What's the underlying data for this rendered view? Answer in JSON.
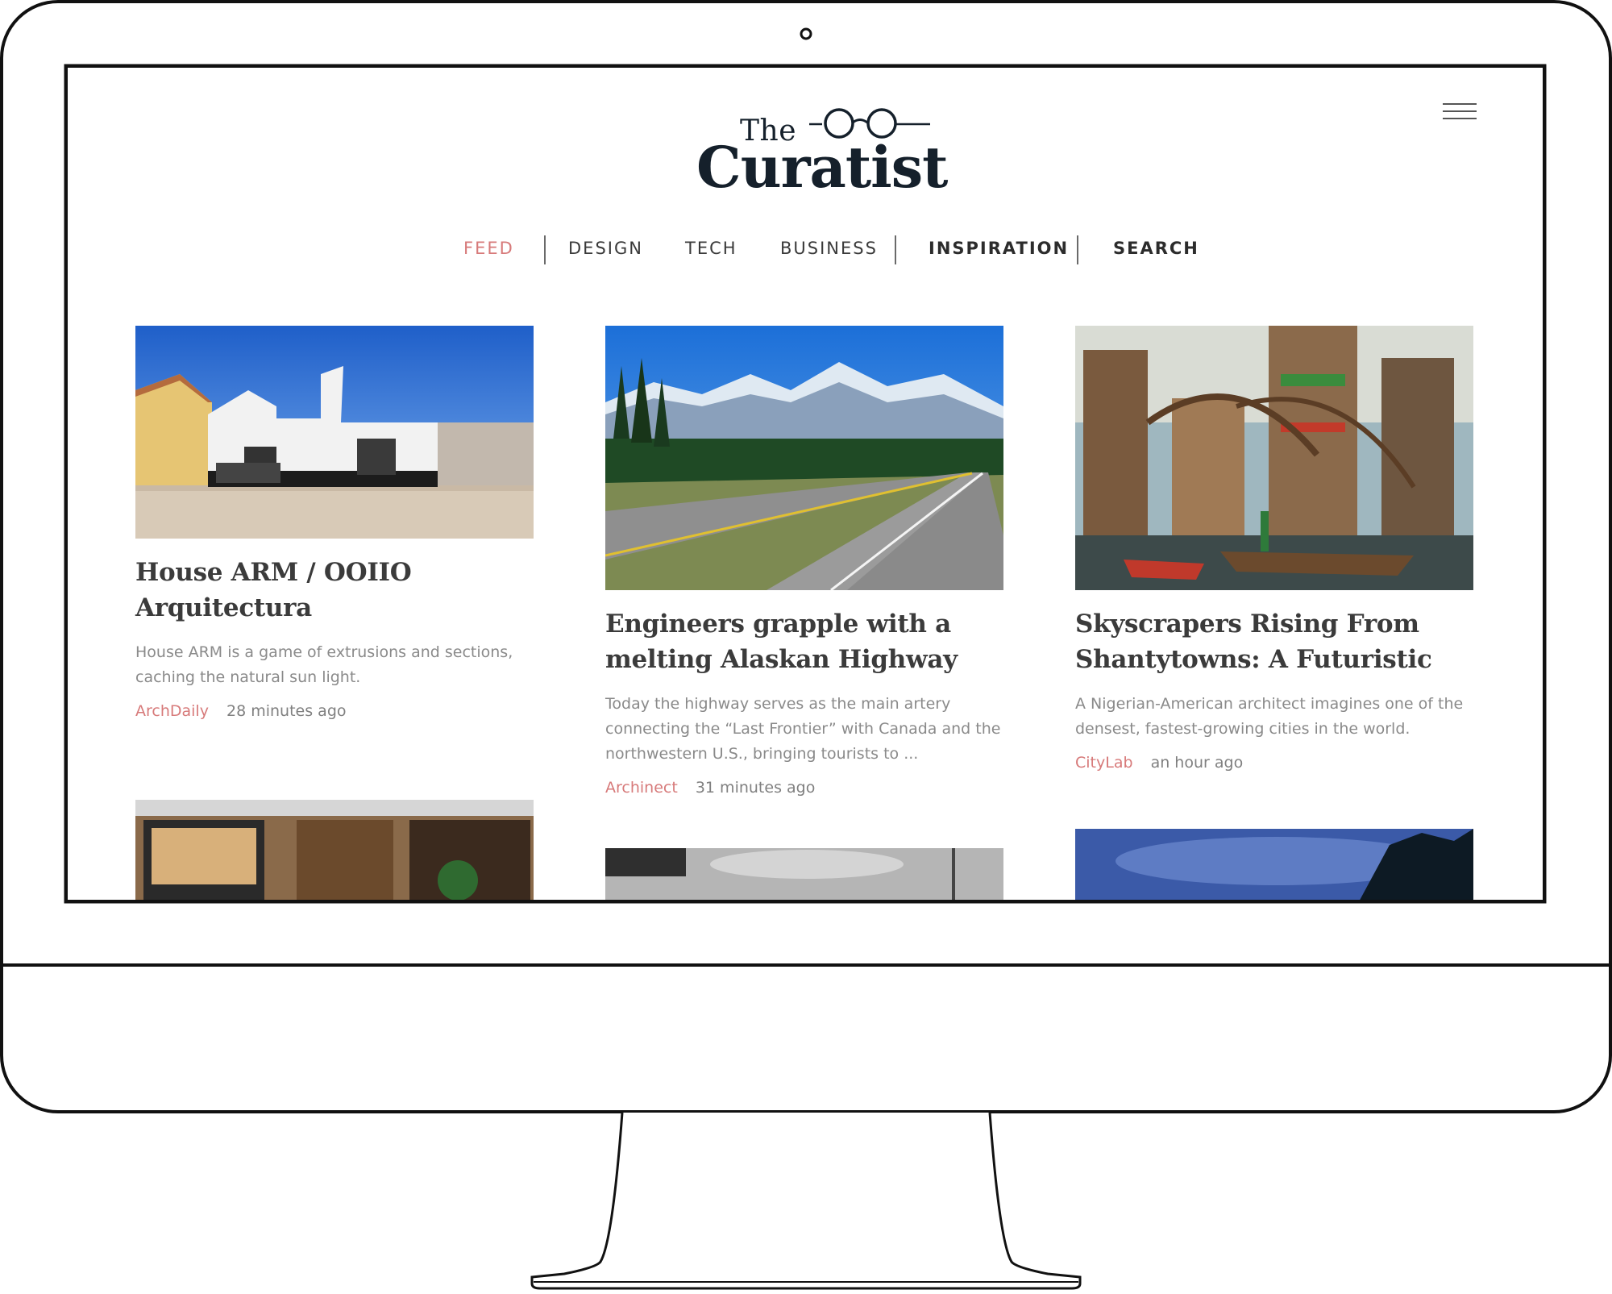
{
  "brand": {
    "logo_the": "The",
    "logo_curatist": "Curatist"
  },
  "nav": {
    "items": [
      {
        "label": "FEED"
      },
      {
        "label": "DESIGN"
      },
      {
        "label": "TECH"
      },
      {
        "label": "BUSINESS"
      },
      {
        "label": "INSPIRATION"
      },
      {
        "label": "SEARCH"
      }
    ],
    "active": "FEED"
  },
  "articles": [
    {
      "title": "House ARM / OOIIO Arquitectura",
      "description": "House ARM is a game of extrusions and sections, caching the natural sun light.",
      "source": "ArchDaily",
      "time": "28 minutes ago"
    },
    {
      "title": "Engineers grapple with a melting Alaskan Highway",
      "description": "Today the highway serves as the main artery connecting the “Last Frontier” with Canada and the northwestern U.S., bringing tourists to ...",
      "source": "Archinect",
      "time": "31 minutes ago"
    },
    {
      "title": "Skyscrapers Rising From Shantytowns: A Futuristic",
      "description": "A Nigerian-American architect imagines one of the densest, fastest-growing cities in the world.",
      "source": "CityLab",
      "time": "an hour ago"
    }
  ],
  "colors": {
    "accent": "#d77a7a",
    "title": "#3b3b3b",
    "muted": "#8a8a8a",
    "frame": "#111111"
  },
  "icons": {
    "menu": "hamburger-menu-icon",
    "logo_glasses": "glasses-icon",
    "camera": "webcam-icon"
  }
}
